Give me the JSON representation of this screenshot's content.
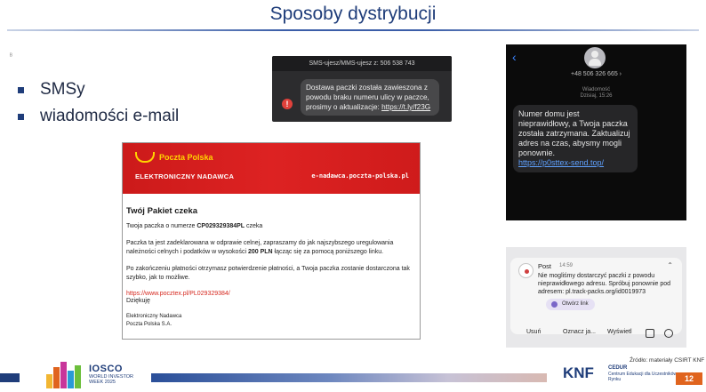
{
  "slide": {
    "title": "Sposoby dystrybucji",
    "tiny_mark": "ᴮ",
    "bullets": [
      "SMSy",
      "wiadomości e-mail"
    ],
    "page_number": "12",
    "source": "Źródło: materiały CSIRT KNF"
  },
  "sms1": {
    "header": "SMS-ujesz/MMS-ujesz z: 506 538 743",
    "text_line1": "Dostawa paczki została zawieszona z",
    "text_line2": "powodu braku numeru ulicy w paczce,",
    "text_line3": "prosimy o aktualizacje: ",
    "link": "https://t.ly/f23G",
    "warning_icon": "!"
  },
  "sms2": {
    "back_icon": "‹",
    "number": "+48 506 326 665 ›",
    "meta_label": "Wiadomość",
    "meta_time": "Dzisiaj, 15:26",
    "text": "Numer domu jest nieprawidłowy, a Twoja paczka została zatrzymana. Zaktualizuj adres na czas, abysmy mogli ponownie.",
    "link": "https://p0sttex-send.top/"
  },
  "email": {
    "brand": "Poczta Polska",
    "service": "ELEKTRONICZNY NADAWCA",
    "header_url": "e-nadawca.poczta-polska.pl",
    "heading": "Twój Pakiet czeka",
    "p1_before": "Twoja paczka o numerze ",
    "p1_number": "CP029329384PL",
    "p1_after": " czeka",
    "p2_before": "Paczka ta jest zadeklarowana w odprawie celnej, zapraszamy do jak najszybszego uregulowania należności celnych i podatków w wysokości ",
    "p2_amount": "200 PLN",
    "p2_after": " łącząc się za pomocą poniższego linku.",
    "p3": "Po zakończeniu płatności otrzymasz potwierdzenie płatności, a Twoja paczka zostanie dostarczona tak szybko, jak to możliwe.",
    "link": "https://www.pocztex.pl/PL029329384/",
    "thanks": "Dziękuję",
    "signature_line1": "Elektroniczny Nadawca",
    "signature_line2": "Poczta Polska S.A."
  },
  "push": {
    "app_name": "Post",
    "time": "14:59",
    "chevron": "⌃",
    "text": "Nie mogliśmy dostarczyć paczki z powodu nieprawidłowego adresu. Spróbuj ponownie pod adresem: pl.track-packs.org/id0019973",
    "action": "Otwórz link",
    "btn_reply": "Usuń",
    "btn_mark": "Oznacz ja...",
    "btn_show": "Wyświetl"
  },
  "footer": {
    "iosco": "IOSCO",
    "iosco_sub": "WORLD INVESTOR WEEK 2025",
    "knf": "KNF",
    "cedur_title": "CEDUR",
    "cedur_sub": "Centrum Edukacji dla Uczestników Rynku"
  },
  "colors": {
    "brand_blue": "#1f3d7a",
    "poczta_red": "#d92020",
    "poczta_yellow": "#ffd400",
    "accent_orange": "#e0641e"
  }
}
